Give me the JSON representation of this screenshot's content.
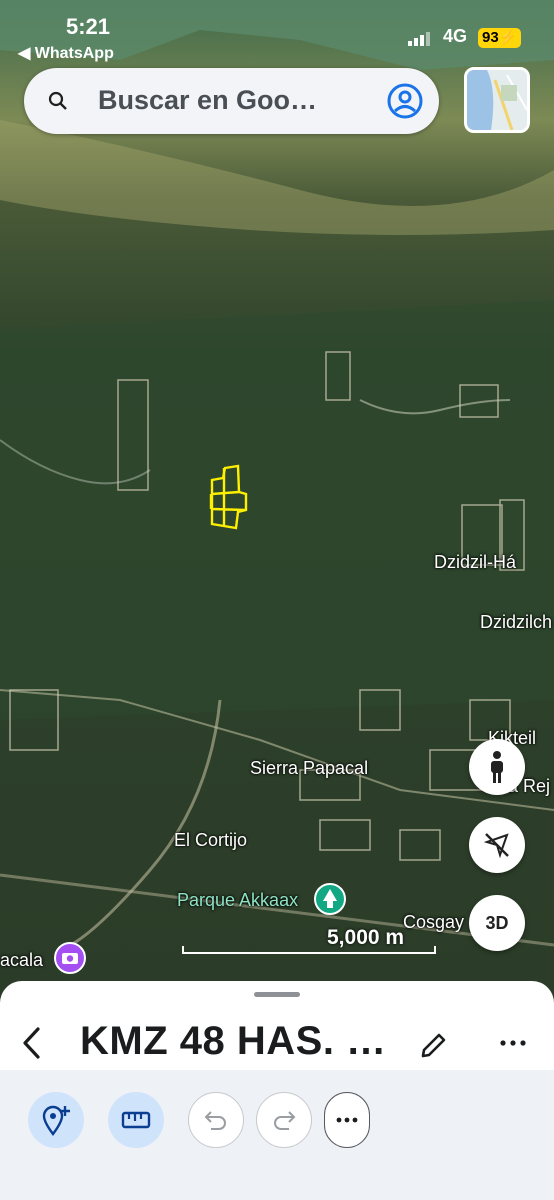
{
  "status_bar": {
    "time": "5:21",
    "back_app": "◀ WhatsApp",
    "network": "4G",
    "battery": "93"
  },
  "search": {
    "placeholder": "Buscar en Goo…"
  },
  "map": {
    "place_labels": [
      {
        "name": "label-dzidzil-ha",
        "text": "Dzidzil-Há"
      },
      {
        "name": "label-dzidzilche",
        "text": "Dzidzilch"
      },
      {
        "name": "label-kikteil",
        "text": "Kikteil"
      },
      {
        "name": "label-la-reja",
        "text": "a Rej"
      },
      {
        "name": "label-sierra-papacal",
        "text": "Sierra Papacal"
      },
      {
        "name": "label-el-cortijo",
        "text": "El Cortijo"
      },
      {
        "name": "label-parque-akkaax",
        "text": "Parque Akkaax"
      },
      {
        "name": "label-cosgaya",
        "text": "Cosgay"
      },
      {
        "name": "label-acala",
        "text": "acala"
      }
    ],
    "scale_text": "5,000 m",
    "button_3d": "3D",
    "colors": {
      "polygon": "#ffef00",
      "park_pin": "#12a883",
      "photo_pin": "#a44ff1"
    }
  },
  "sheet": {
    "title": "KMZ 48 HAS. …"
  },
  "toolbar": {
    "buttons": [
      "add-placemark",
      "measure",
      "undo",
      "redo",
      "more-options"
    ]
  }
}
